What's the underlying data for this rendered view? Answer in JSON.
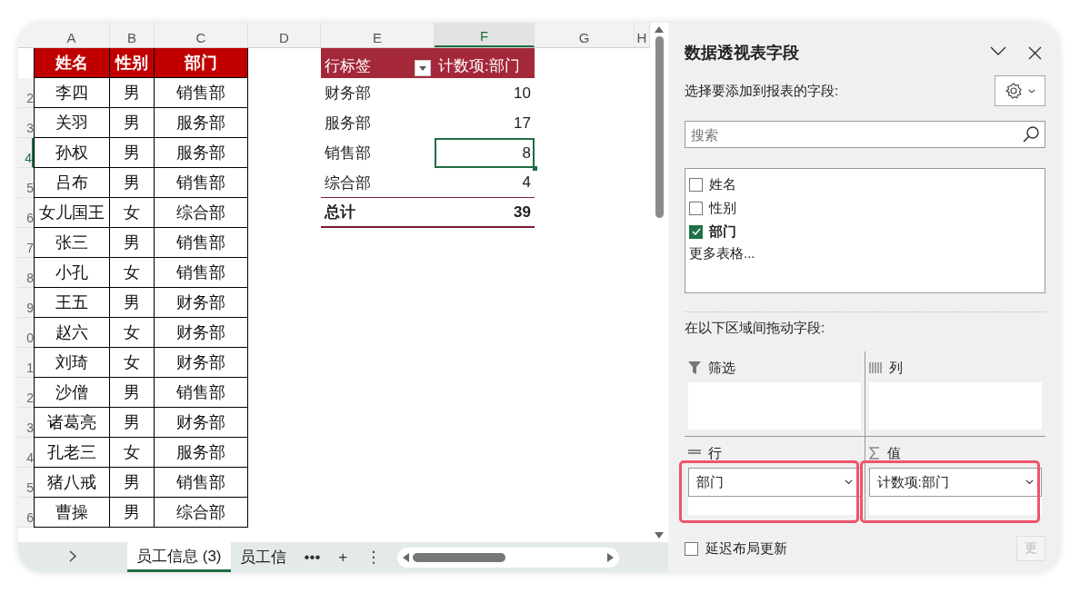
{
  "sheet": {
    "columns": [
      {
        "label": "A",
        "selected": false
      },
      {
        "label": "B",
        "selected": false
      },
      {
        "label": "C",
        "selected": false
      },
      {
        "label": "D",
        "selected": false
      },
      {
        "label": "E",
        "selected": false
      },
      {
        "label": "F",
        "selected": true
      },
      {
        "label": "G",
        "selected": false
      },
      {
        "label": "H",
        "selected": false
      }
    ],
    "header": [
      "姓名",
      "性别",
      "部门"
    ],
    "rows": [
      {
        "num": "2",
        "selected": false,
        "cells": [
          "李四",
          "男",
          "销售部"
        ]
      },
      {
        "num": "3",
        "selected": false,
        "cells": [
          "关羽",
          "男",
          "服务部"
        ]
      },
      {
        "num": "4",
        "selected": true,
        "cells": [
          "孙权",
          "男",
          "服务部"
        ]
      },
      {
        "num": "5",
        "selected": false,
        "cells": [
          "吕布",
          "男",
          "销售部"
        ]
      },
      {
        "num": "6",
        "selected": false,
        "cells": [
          "女儿国王",
          "女",
          "综合部"
        ]
      },
      {
        "num": "7",
        "selected": false,
        "cells": [
          "张三",
          "男",
          "销售部"
        ]
      },
      {
        "num": "8",
        "selected": false,
        "cells": [
          "小孔",
          "女",
          "销售部"
        ]
      },
      {
        "num": "9",
        "selected": false,
        "cells": [
          "王五",
          "男",
          "财务部"
        ]
      },
      {
        "num": "0",
        "selected": false,
        "cells": [
          "赵六",
          "女",
          "财务部"
        ]
      },
      {
        "num": "1",
        "selected": false,
        "cells": [
          "刘琦",
          "女",
          "财务部"
        ]
      },
      {
        "num": "2",
        "selected": false,
        "cells": [
          "沙僧",
          "男",
          "销售部"
        ]
      },
      {
        "num": "3",
        "selected": false,
        "cells": [
          "诸葛亮",
          "男",
          "财务部"
        ]
      },
      {
        "num": "4",
        "selected": false,
        "cells": [
          "孔老三",
          "女",
          "服务部"
        ]
      },
      {
        "num": "5",
        "selected": false,
        "cells": [
          "猪八戒",
          "男",
          "销售部"
        ]
      },
      {
        "num": "6",
        "selected": false,
        "cells": [
          "曹操",
          "男",
          "综合部"
        ]
      }
    ]
  },
  "pivot": {
    "row_label": "行标签",
    "value_label": "计数项:部门",
    "rows": [
      {
        "label": "财务部",
        "value": "10",
        "selected": false
      },
      {
        "label": "服务部",
        "value": "17",
        "selected": false
      },
      {
        "label": "销售部",
        "value": "8",
        "selected": true
      },
      {
        "label": "综合部",
        "value": "4",
        "selected": false
      }
    ],
    "total": {
      "label": "总计",
      "value": "39"
    }
  },
  "sheet_tabs": [
    {
      "label": "员工信息 (3)",
      "selected": true
    },
    {
      "label": "员工信",
      "selected": false
    }
  ],
  "tab_more": "•••",
  "tab_add": "+",
  "tab_menu": "⋮",
  "panel": {
    "title": "数据透视表字段",
    "prompt": "选择要添加到报表的字段:",
    "search": {
      "placeholder": "搜索"
    },
    "fields": [
      {
        "label": "姓名",
        "checked": false
      },
      {
        "label": "性别",
        "checked": false
      },
      {
        "label": "部门",
        "checked": true
      }
    ],
    "more_tables": "更多表格...",
    "areas_prompt": "在以下区域间拖动字段:",
    "areas": [
      {
        "kind": "filter",
        "label": "筛选",
        "highlighted": false
      },
      {
        "kind": "columns",
        "label": "列",
        "highlighted": false
      },
      {
        "kind": "rows",
        "label": "行",
        "highlighted": true,
        "items": [
          "部门"
        ]
      },
      {
        "kind": "values",
        "label": "值",
        "highlighted": true,
        "items": [
          "计数项:部门"
        ]
      }
    ],
    "defer": {
      "label": "延迟布局更新",
      "checked": false
    },
    "update_button": {
      "label": "更",
      "disabled": true
    }
  }
}
